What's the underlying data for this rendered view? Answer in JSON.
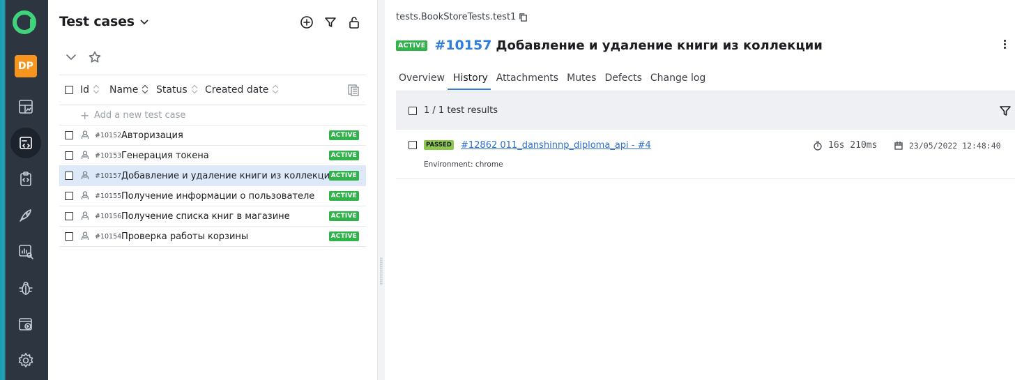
{
  "sidebar": {
    "avatar_initials": "DP",
    "items": [
      {
        "icon": "dashboard-icon"
      },
      {
        "icon": "test-cases-icon",
        "active": true
      },
      {
        "icon": "test-plans-icon"
      },
      {
        "icon": "launches-icon"
      },
      {
        "icon": "analytics-icon"
      },
      {
        "icon": "defects-icon"
      },
      {
        "icon": "jobs-icon"
      },
      {
        "icon": "settings-icon"
      }
    ]
  },
  "left_panel": {
    "title": "Test cases",
    "columns": {
      "id": "Id",
      "name": "Name",
      "status": "Status",
      "created": "Created date"
    },
    "add_label": "Add a new test case",
    "rows": [
      {
        "id": "#10152",
        "name": "Авторизация",
        "status": "ACTIVE"
      },
      {
        "id": "#10153",
        "name": "Генерация токена",
        "status": "ACTIVE"
      },
      {
        "id": "#10157",
        "name": "Добавление и удаление книги из коллекции",
        "status": "ACTIVE",
        "selected": true
      },
      {
        "id": "#10155",
        "name": "Получение информации о пользователе",
        "status": "ACTIVE"
      },
      {
        "id": "#10156",
        "name": "Получение списка книг в магазине",
        "status": "ACTIVE"
      },
      {
        "id": "#10154",
        "name": "Проверка работы корзины",
        "status": "ACTIVE"
      }
    ]
  },
  "detail": {
    "path": "tests.BookStoreTests.test1",
    "status": "ACTIVE",
    "id": "#10157",
    "name": "Добавление и удаление книги из коллекции",
    "tabs": [
      "Overview",
      "History",
      "Attachments",
      "Mutes",
      "Defects",
      "Change log"
    ],
    "active_tab": "History",
    "results_count": "1 / 1 test results",
    "results": [
      {
        "status": "PASSED",
        "link": "#12862 011_danshinnp_diploma_api - #4",
        "environment": "Environment: chrome",
        "duration": "16s 210ms",
        "date": "23/05/2022 12:48:40"
      }
    ]
  },
  "colors": {
    "accent": "#2f7ee0",
    "active_badge": "#2fb34a",
    "passed_badge": "#8cc74e",
    "rail": "#2d3541",
    "avatar": "#f7941d"
  }
}
